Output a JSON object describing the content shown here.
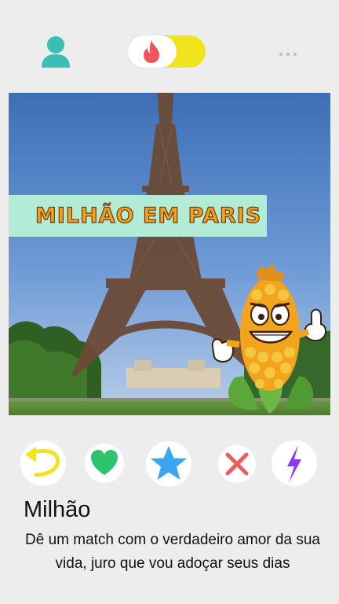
{
  "header": {
    "profile_icon": "user-icon",
    "toggle_icon": "flame-icon",
    "toggle_state": "on",
    "more_icon": "ellipsis-icon"
  },
  "colors": {
    "background": "#ededed",
    "accent_teal": "#3bbfb5",
    "toggle_yellow": "#f2e41a",
    "flame_red": "#f2545b",
    "banner_mint": "#b3ecd6",
    "banner_text": "#f4a21a",
    "rewind_yellow": "#f2e41a",
    "like_green": "#2ec46f",
    "super_blue": "#3aa5f0",
    "nope_red": "#ee5c5c",
    "boost_purple": "#8a3cf0"
  },
  "card": {
    "banner_text": "MILHÃO EM PARIS",
    "photo_subject": "eiffel-tower-photo",
    "mascot": "corn-mascot-icon"
  },
  "actions": [
    {
      "name": "rewind",
      "icon": "rewind-icon"
    },
    {
      "name": "like",
      "icon": "heart-icon"
    },
    {
      "name": "super-like",
      "icon": "star-icon"
    },
    {
      "name": "nope",
      "icon": "close-icon"
    },
    {
      "name": "boost",
      "icon": "bolt-icon"
    }
  ],
  "profile": {
    "name": "Milhão",
    "bio": "Dê um match com o verdadeiro amor da sua vida, juro que vou adoçar seus dias"
  }
}
